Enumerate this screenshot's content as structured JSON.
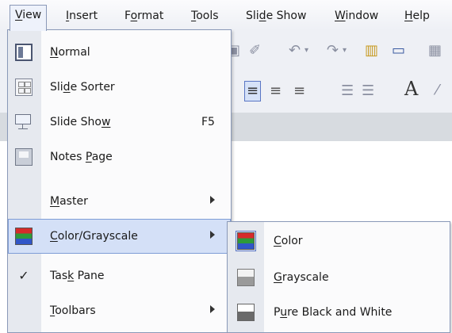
{
  "menubar": {
    "items": [
      {
        "label": "View",
        "accel": "V",
        "rest": "iew",
        "active": true
      },
      {
        "label": "Insert",
        "accel": "I",
        "rest": "nsert"
      },
      {
        "label": "Format",
        "pre": "F",
        "accel": "o",
        "rest": "rmat"
      },
      {
        "label": "Tools",
        "accel": "T",
        "rest": "ools"
      },
      {
        "label": "Slide Show",
        "pre": "Sli",
        "accel": "d",
        "rest": "e Show"
      },
      {
        "label": "Window",
        "accel": "W",
        "rest": "indow"
      },
      {
        "label": "Help",
        "accel": "H",
        "rest": "elp"
      }
    ]
  },
  "view_menu": {
    "items": [
      {
        "pre": "",
        "accel": "N",
        "rest": "ormal",
        "icon": "normal-view-icon"
      },
      {
        "pre": "Sli",
        "accel": "d",
        "rest": "e Sorter",
        "icon": "slide-sorter-icon"
      },
      {
        "pre": "Slide Sho",
        "accel": "w",
        "rest": "",
        "shortcut": "F5",
        "icon": "slide-show-icon"
      },
      {
        "pre": "Notes ",
        "accel": "P",
        "rest": "age",
        "icon": "notes-page-icon"
      },
      {
        "pre": "",
        "accel": "M",
        "rest": "aster",
        "submenu": true
      },
      {
        "pre": "",
        "accel": "C",
        "rest": "olor/Grayscale",
        "submenu": true,
        "highlighted": true,
        "icon": "color-grayscale-icon"
      },
      {
        "pre": "Tas",
        "accel": "k",
        "rest": " Pane",
        "checked": true,
        "icon": "checkmark-icon"
      },
      {
        "pre": "",
        "accel": "T",
        "rest": "oolbars",
        "submenu": true
      }
    ]
  },
  "sub_menu": {
    "items": [
      {
        "pre": "",
        "accel": "C",
        "rest": "olor",
        "icon": "color-icon"
      },
      {
        "pre": "",
        "accel": "G",
        "rest": "rayscale",
        "icon": "grayscale-icon"
      },
      {
        "pre": "P",
        "accel": "u",
        "rest": "re Black and White",
        "icon": "pure-black-white-icon"
      }
    ]
  },
  "colors": {
    "highlight": "#d4e0f7",
    "border": "#8a99b8"
  }
}
